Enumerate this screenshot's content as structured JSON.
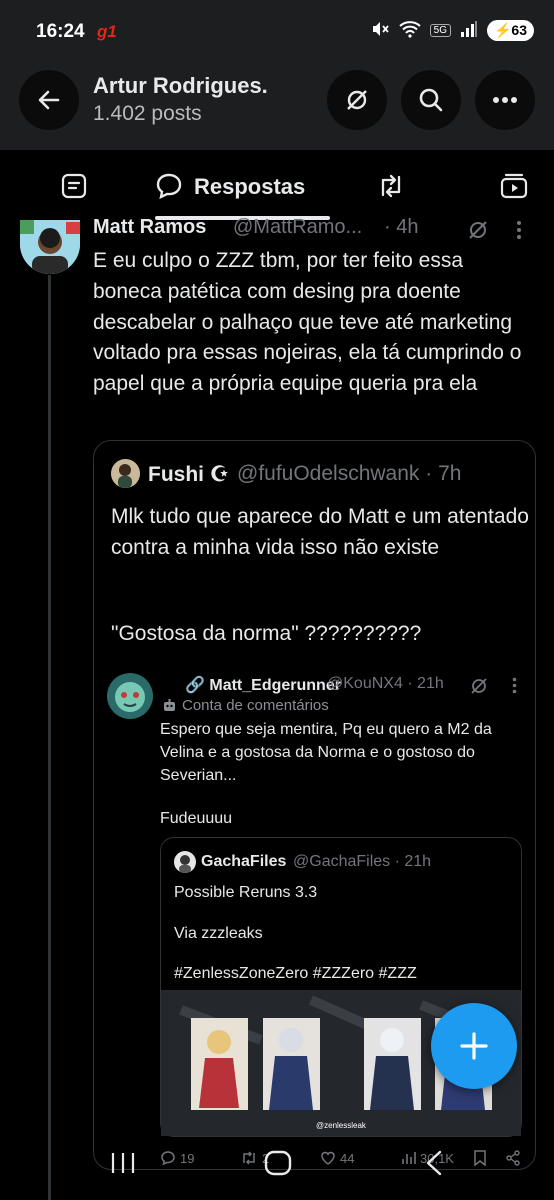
{
  "status_bar": {
    "time": "16:24",
    "app_badge": "g1",
    "network": "5G",
    "battery": "63"
  },
  "header": {
    "name": "Artur Rodrigues.",
    "posts": "1.402 posts"
  },
  "tabs": {
    "active_label": "Respostas"
  },
  "post": {
    "name": "Matt Ramos",
    "handle": "@MattRamo...",
    "time": "· 4h",
    "text": "E eu culpo o ZZZ tbm, por ter feito essa boneca patética com desing pra doente descabelar o palhaço que teve até marketing voltado pra essas nojeiras, ela tá cumprindo o papel que a própria equipe queria pra ela"
  },
  "quote1": {
    "name": "Fushi ☪",
    "handle": "@fufuOdelschwank · 7h",
    "text": "Mlk tudo que aparece do Matt e um atentado contra a minha vida isso não existe",
    "text2": "\"Gostosa da norma\" ??????????"
  },
  "quote2": {
    "name": "🔗 Matt_Edgerunner",
    "handle": "@KouNX4 · 21h",
    "sub": "Conta de comentários",
    "text": "Espero que seja mentira, Pq eu quero a M2 da Velina e a gostosa da Norma e o gostoso do Severian...",
    "text2": "Fudeuuuu"
  },
  "quote3": {
    "name": "GachaFiles",
    "handle": "@GachaFiles · 21h",
    "line1": "Possible Reruns 3.3",
    "line2": "Via zzzleaks",
    "line3": "#ZenlessZoneZero #ZZZero #ZZZ",
    "media_credit": "@zenlessleak"
  },
  "actions": {
    "replies": "19",
    "reposts": "2",
    "likes": "44",
    "views": "30,1K"
  },
  "colors": {
    "accent": "#1d9bf0",
    "background": "#000000",
    "header_bg": "#1c1e20",
    "muted": "#71767b"
  }
}
